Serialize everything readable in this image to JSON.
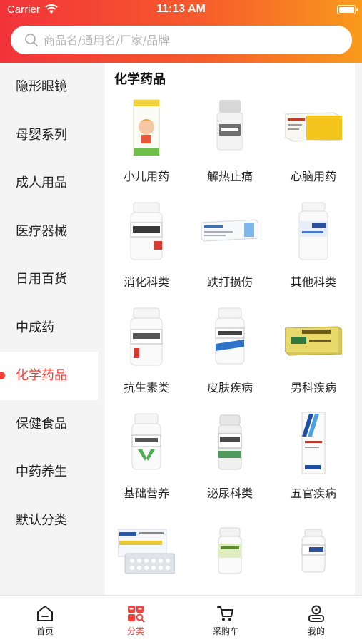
{
  "status_bar": {
    "carrier": "Carrier",
    "time": "11:13 AM"
  },
  "search": {
    "placeholder": "商品名/通用名/厂家/品牌"
  },
  "sidebar": {
    "items": [
      {
        "label": "隐形眼镜"
      },
      {
        "label": "母婴系列"
      },
      {
        "label": "成人用品"
      },
      {
        "label": "医疗器械"
      },
      {
        "label": "日用百货"
      },
      {
        "label": "中成药"
      },
      {
        "label": "化学药品"
      },
      {
        "label": "保健食品"
      },
      {
        "label": "中药养生"
      },
      {
        "label": "默认分类"
      }
    ],
    "active_index": 6
  },
  "content": {
    "section_title": "化学药品",
    "categories": [
      {
        "label": "小儿用药",
        "image": "child-medicine-box"
      },
      {
        "label": "解热止痛",
        "image": "white-pill-bottle"
      },
      {
        "label": "心脑用药",
        "image": "yellow-medicine-box"
      },
      {
        "label": "消化科类",
        "image": "white-bottle-red-label"
      },
      {
        "label": "跌打损伤",
        "image": "ointment-tube-box"
      },
      {
        "label": "其他科类",
        "image": "white-bottle-blue-label"
      },
      {
        "label": "抗生素类",
        "image": "white-bottle-red-label"
      },
      {
        "label": "皮肤疾病",
        "image": "white-bottle-blue-label"
      },
      {
        "label": "男科疾病",
        "image": "cialis-box"
      },
      {
        "label": "基础营养",
        "image": "vitamin-bottle"
      },
      {
        "label": "泌尿科类",
        "image": "grey-bottle"
      },
      {
        "label": "五官疾病",
        "image": "eye-drops-box"
      },
      {
        "label": "",
        "image": "blister-pack-box"
      },
      {
        "label": "",
        "image": "white-bottle-green-label"
      },
      {
        "label": "",
        "image": "white-bottle-blue-label"
      }
    ]
  },
  "tabbar": {
    "items": [
      {
        "label": "首页",
        "icon": "home-icon"
      },
      {
        "label": "分类",
        "icon": "category-icon"
      },
      {
        "label": "采购车",
        "icon": "cart-icon"
      },
      {
        "label": "我的",
        "icon": "profile-icon"
      }
    ],
    "active_index": 1
  },
  "colors": {
    "accent": "#f5403a",
    "header_start": "#f2333a",
    "header_end": "#f99a1c"
  }
}
